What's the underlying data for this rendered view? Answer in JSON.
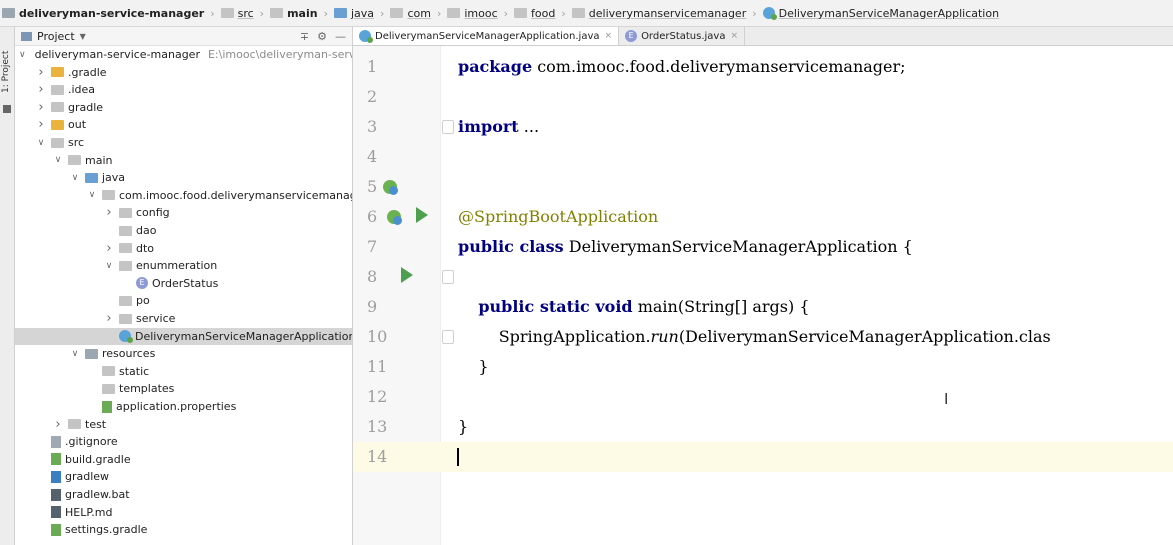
{
  "breadcrumbs": [
    {
      "label": "deliveryman-service-manager",
      "icon": "module-folder-icon",
      "bold": true
    },
    {
      "label": "src",
      "icon": "folder-icon"
    },
    {
      "label": "main",
      "icon": "folder-icon",
      "bold": true
    },
    {
      "label": "java",
      "icon": "source-folder-icon"
    },
    {
      "label": "com",
      "icon": "package-icon"
    },
    {
      "label": "imooc",
      "icon": "package-icon"
    },
    {
      "label": "food",
      "icon": "package-icon"
    },
    {
      "label": "deliverymanservicemanager",
      "icon": "package-icon"
    },
    {
      "label": "DeliverymanServiceManagerApplication",
      "icon": "spring-class-icon"
    }
  ],
  "tool_strip": {
    "label": "1: Project"
  },
  "project_panel": {
    "title": "Project",
    "tree": [
      {
        "label": "deliveryman-service-manager",
        "path": "E:\\imooc\\deliveryman-service-r",
        "depth": 0,
        "arrow": "down",
        "icon": "module-folder-icon"
      },
      {
        "label": ".gradle",
        "depth": 1,
        "arrow": "right",
        "icon": "orange-folder-icon"
      },
      {
        "label": ".idea",
        "depth": 1,
        "arrow": "right",
        "icon": "folder-icon"
      },
      {
        "label": "gradle",
        "depth": 1,
        "arrow": "right",
        "icon": "folder-icon"
      },
      {
        "label": "out",
        "depth": 1,
        "arrow": "right",
        "icon": "orange-folder-icon"
      },
      {
        "label": "src",
        "depth": 1,
        "arrow": "down",
        "icon": "folder-icon"
      },
      {
        "label": "main",
        "depth": 2,
        "arrow": "down",
        "icon": "folder-icon"
      },
      {
        "label": "java",
        "depth": 3,
        "arrow": "down",
        "icon": "source-folder-icon"
      },
      {
        "label": "com.imooc.food.deliverymanservicemanager",
        "depth": 4,
        "arrow": "down",
        "icon": "package-icon"
      },
      {
        "label": "config",
        "depth": 5,
        "arrow": "right",
        "icon": "package-icon"
      },
      {
        "label": "dao",
        "depth": 5,
        "arrow": "",
        "icon": "package-icon"
      },
      {
        "label": "dto",
        "depth": 5,
        "arrow": "right",
        "icon": "package-icon"
      },
      {
        "label": "enummeration",
        "depth": 5,
        "arrow": "down",
        "icon": "package-icon"
      },
      {
        "label": "OrderStatus",
        "depth": 6,
        "arrow": "",
        "icon": "enum-icon"
      },
      {
        "label": "po",
        "depth": 5,
        "arrow": "",
        "icon": "package-icon"
      },
      {
        "label": "service",
        "depth": 5,
        "arrow": "right",
        "icon": "package-icon"
      },
      {
        "label": "DeliverymanServiceManagerApplication",
        "depth": 5,
        "arrow": "",
        "icon": "spring-class-icon",
        "selected": true
      },
      {
        "label": "resources",
        "depth": 3,
        "arrow": "down",
        "icon": "resources-folder-icon"
      },
      {
        "label": "static",
        "depth": 4,
        "arrow": "",
        "icon": "folder-icon"
      },
      {
        "label": "templates",
        "depth": 4,
        "arrow": "",
        "icon": "folder-icon"
      },
      {
        "label": "application.properties",
        "depth": 4,
        "arrow": "",
        "icon": "spring-properties-icon"
      },
      {
        "label": "test",
        "depth": 2,
        "arrow": "right",
        "icon": "folder-icon"
      },
      {
        "label": ".gitignore",
        "depth": 1,
        "arrow": "",
        "icon": "file-icon"
      },
      {
        "label": "build.gradle",
        "depth": 1,
        "arrow": "",
        "icon": "gradle-icon"
      },
      {
        "label": "gradlew",
        "depth": 1,
        "arrow": "",
        "icon": "script-icon"
      },
      {
        "label": "gradlew.bat",
        "depth": 1,
        "arrow": "",
        "icon": "bat-file-icon"
      },
      {
        "label": "HELP.md",
        "depth": 1,
        "arrow": "",
        "icon": "markdown-icon"
      },
      {
        "label": "settings.gradle",
        "depth": 1,
        "arrow": "",
        "icon": "gradle-icon"
      }
    ]
  },
  "tabs": [
    {
      "label": "DeliverymanServiceManagerApplication.java",
      "active": true
    },
    {
      "label": "OrderStatus.java",
      "active": false
    }
  ],
  "editor": {
    "lines": [
      {
        "n": "1",
        "html": "<span class=\"kw\">package</span> com.imooc.food.deliverymanservicemanager;"
      },
      {
        "n": "2",
        "html": ""
      },
      {
        "n": "3",
        "html": "<span class=\"kw\">import</span> ..."
      },
      {
        "n": "4",
        "html": ""
      },
      {
        "n": "5",
        "html": ""
      },
      {
        "n": "6",
        "html": "<span class=\"ann\">@SpringBootApplication</span>"
      },
      {
        "n": "7",
        "html": "<span class=\"kw\">public class</span> DeliverymanServiceManagerApplication {"
      },
      {
        "n": "8",
        "html": ""
      },
      {
        "n": "9",
        "html": "    <span class=\"kw\">public static void</span> main(String[] args) {"
      },
      {
        "n": "10",
        "html": "        SpringApplication.<span class=\"ital\">run</span>(DeliverymanServiceManagerApplication.clas"
      },
      {
        "n": "11",
        "html": "    }"
      },
      {
        "n": "12",
        "html": ""
      },
      {
        "n": "13",
        "html": "}"
      },
      {
        "n": "14",
        "html": ""
      }
    ]
  }
}
